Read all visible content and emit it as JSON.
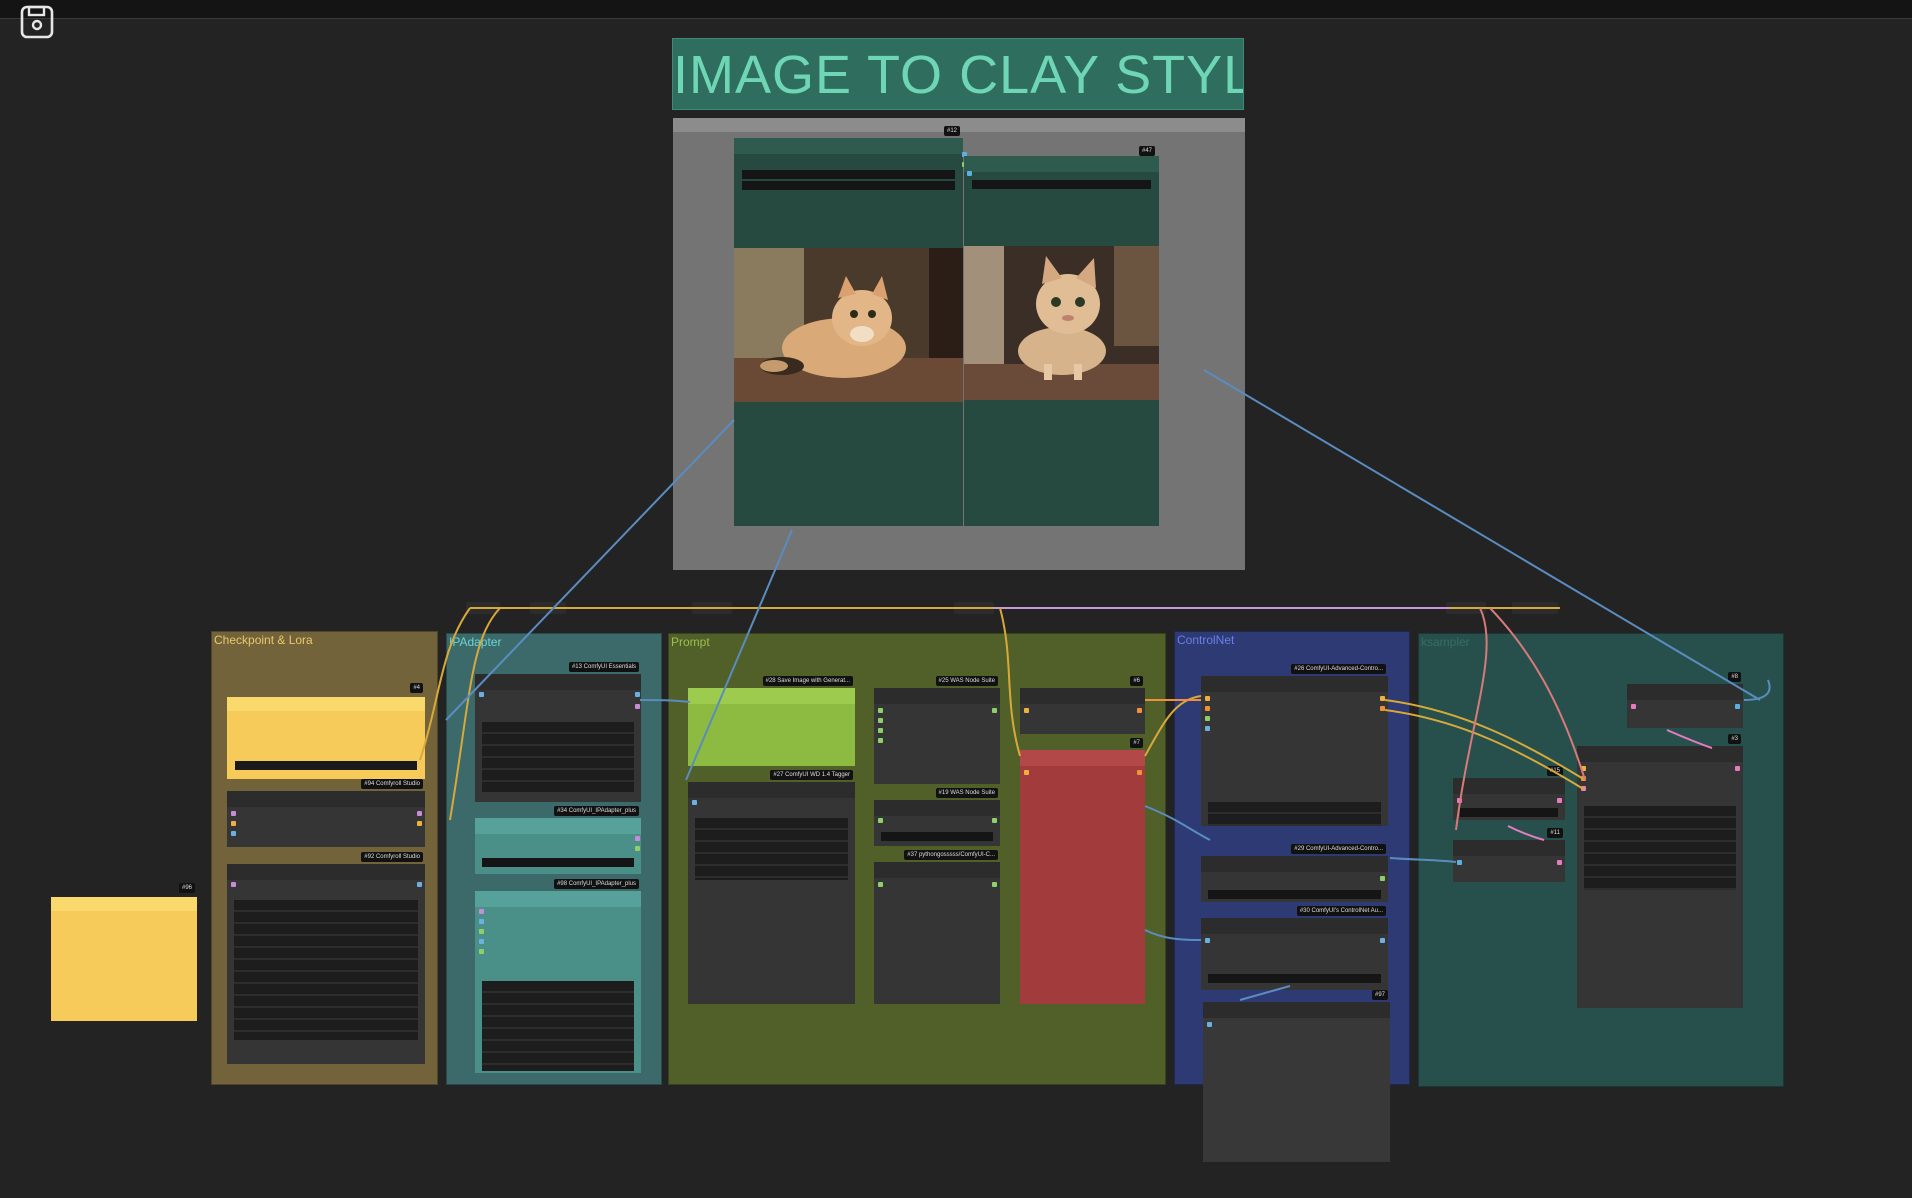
{
  "workflow": {
    "title": "IMAGE TO CLAY STYLE"
  },
  "toolbar": {
    "save_icon": "floppy-save-icon"
  },
  "preview": {
    "left_node_id": "#12",
    "right_node_id": "#47",
    "left_image": "photo of a tabby kitten lying on a wooden floor",
    "right_image": "clay-style cat standing on a wooden floor"
  },
  "groups": {
    "checkpoint": "Checkpoint & Lora",
    "ipadapter": "IPAdapter",
    "prompt": "Prompt",
    "controlnet": "ControlNet",
    "ksampler": "ksampler"
  },
  "nodes": {
    "n4": "#4",
    "n94": "#94 Comfyroll Studio",
    "n92": "#92 Comfyroll Studio",
    "n96": "#96",
    "n13": "#13 ComfyUI Essentials",
    "n34": "#34 ComfyUI_IPAdapter_plus",
    "n98": "#98 ComfyUI_IPAdapter_plus",
    "n28": "#28 Save Image with Generat...",
    "n27": "#27 ComfyUI WD 1.4 Tagger",
    "n25": "#25 WAS Node Suite",
    "n19": "#19 WAS Node Suite",
    "n37": "#37 pythongosssss/ComfyUI-C...",
    "n6": "#6",
    "n7": "#7",
    "n26": "#26 ComfyUI-Advanced-Contro...",
    "n29": "#29 ComfyUI-Advanced-Contro...",
    "n30": "#30 ComfyUI's ControlNet Au...",
    "n97": "#97",
    "n8": "#8",
    "n3": "#3",
    "n15": "#15",
    "n11": "#11"
  },
  "colors": {
    "checkpoint_group": "#7a6a3a",
    "ipadapter_group": "#3f6f70",
    "prompt_group": "#55662b",
    "controlnet_group": "#2f3c78",
    "ksampler_group": "#28524f",
    "sticky_yellow": "#f7cb5a",
    "lime_node": "#8dbb41",
    "red_node": "#a23b3b",
    "teal_node": "#4a9089"
  }
}
